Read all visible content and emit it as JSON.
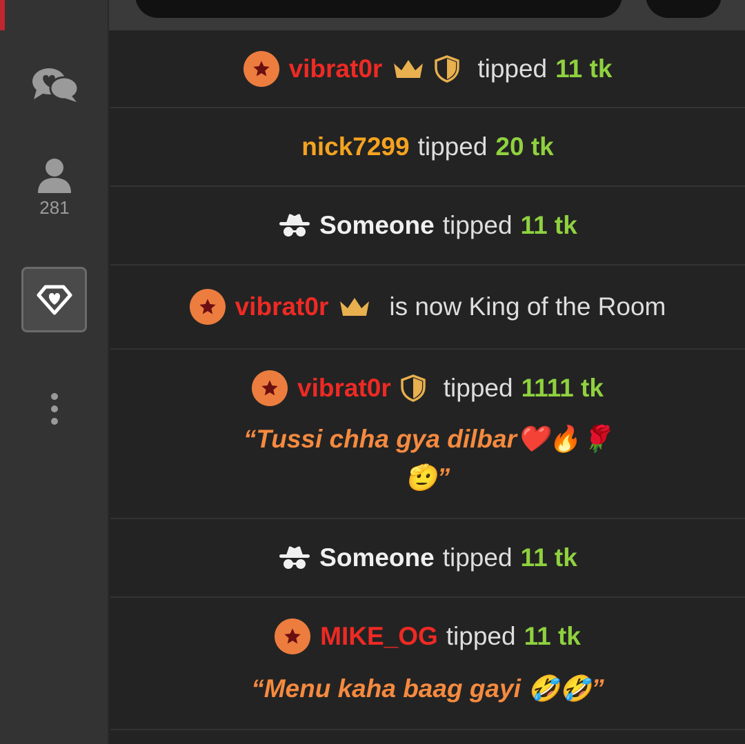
{
  "sidebar": {
    "online_count": "281"
  },
  "feed": {
    "rows": [
      {
        "user": "vibrat0r",
        "action": "tipped",
        "amount": "11 tk"
      },
      {
        "user": "nick7299",
        "action": "tipped",
        "amount": "20 tk"
      },
      {
        "user": "Someone",
        "action": "tipped",
        "amount": "11 tk"
      },
      {
        "user": "vibrat0r",
        "action": "is now King of the Room"
      },
      {
        "user": "vibrat0r",
        "action": "tipped",
        "amount": "1111 tk",
        "message_line1": "“Tussi chha gya dilbar❤️🔥🌹",
        "message_line2": "🫡”"
      },
      {
        "user": "Someone",
        "action": "tipped",
        "amount": "11 tk"
      },
      {
        "user": "MIKE_OG",
        "action": "tipped",
        "amount": "11 tk",
        "message_line1": "“Menu kaha baag gayi 🤣🤣”"
      }
    ]
  },
  "colors": {
    "username_red": "#ee2a24",
    "username_orange": "#f4a320",
    "amount_green": "#8fd13f",
    "message_orange": "#f58a3f",
    "crown_gold": "#e8b04e"
  },
  "icons": {
    "chat": "chat-bubbles-icon",
    "users": "user-icon",
    "gem": "diamond-icon",
    "more": "more-vertical-icon",
    "badge": "star-badge-icon",
    "crown": "crown-icon",
    "shield": "shield-icon",
    "anon": "spy-incognito-icon"
  }
}
